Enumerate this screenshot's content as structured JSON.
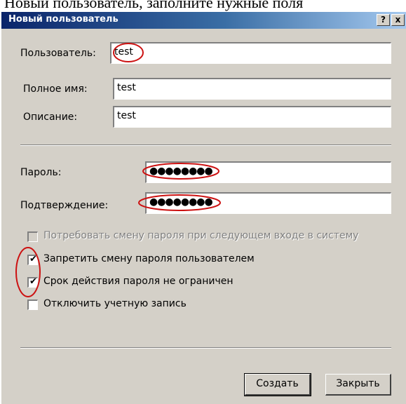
{
  "background_caption": "Новый пользователь, заполните нужные поля",
  "window": {
    "title": "Новый пользователь",
    "help_label": "?",
    "close_label": "x"
  },
  "fields": {
    "user_label": "Пользователь:",
    "user_value": "test",
    "fullname_label": "Полное имя:",
    "fullname_value": "test",
    "description_label": "Описание:",
    "description_value": "test",
    "password_label": "Пароль:",
    "password_value": "●●●●●●●●",
    "confirm_label": "Подтверждение:",
    "confirm_value": "●●●●●●●●"
  },
  "options": [
    {
      "label": "Потребовать смену пароля при следующем входе в систему",
      "checked": false,
      "disabled": true
    },
    {
      "label": "Запретить смену пароля пользователем",
      "checked": true,
      "disabled": false
    },
    {
      "label": "Срок действия пароля не ограничен",
      "checked": true,
      "disabled": false
    },
    {
      "label": "Отключить учетную запись",
      "checked": false,
      "disabled": false
    }
  ],
  "buttons": {
    "create": "Создать",
    "close": "Закрыть"
  },
  "colors": {
    "titlebar_start": "#0a246a",
    "titlebar_end": "#a6caf0",
    "dialog_face": "#d4d0c8",
    "annotation": "#cc1111"
  },
  "checkmark_glyph": "✔"
}
